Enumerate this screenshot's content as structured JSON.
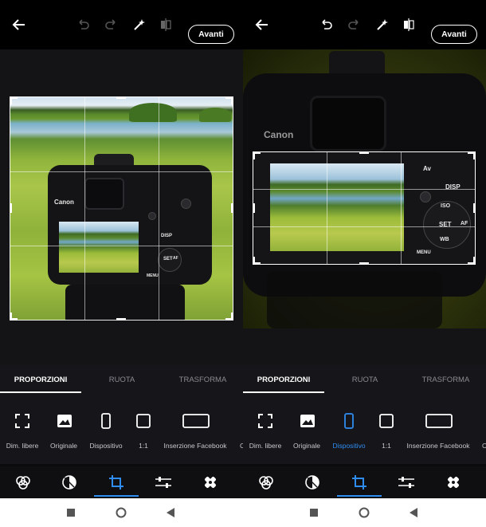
{
  "toolbar": {
    "back_icon": "arrow-left-icon",
    "undo_icon": "undo-icon",
    "redo_icon": "redo-icon",
    "auto_icon": "magic-wand-icon",
    "compare_icon": "compare-icon",
    "next_label": "Avanti"
  },
  "tabs": [
    {
      "label": "PROPORZIONI",
      "active": true
    },
    {
      "label": "RUOTA",
      "active": false
    },
    {
      "label": "TRASFORMA",
      "active": false
    }
  ],
  "screens": [
    {
      "selected_option": "Originale",
      "options": [
        {
          "label": "Dim. libere",
          "icon": "free-size-icon"
        },
        {
          "label": "Originale",
          "icon": "image-icon"
        },
        {
          "label": "Dispositivo",
          "icon": "phone-icon"
        },
        {
          "label": "1:1",
          "icon": "square-icon"
        },
        {
          "label": "Inserzione Facebook",
          "icon": "wide-rect-icon"
        },
        {
          "label": "C",
          "icon": ""
        }
      ]
    },
    {
      "selected_option": "Dispositivo",
      "options": [
        {
          "label": "Dim. libere",
          "icon": "free-size-icon"
        },
        {
          "label": "Originale",
          "icon": "image-icon"
        },
        {
          "label": "Dispositivo",
          "icon": "phone-icon"
        },
        {
          "label": "1:1",
          "icon": "square-icon"
        },
        {
          "label": "Inserzione Facebook",
          "icon": "wide-rect-icon"
        },
        {
          "label": "C",
          "icon": ""
        }
      ]
    }
  ],
  "camera": {
    "brand": "Canon",
    "buttons": [
      "DISP",
      "SET",
      "AF",
      "ISO",
      "WB",
      "MENU",
      "Av"
    ]
  },
  "bottom_tools": [
    "looks-icon",
    "adjust-circle-icon",
    "crop-icon",
    "sliders-icon",
    "healing-icon"
  ],
  "active_tool": "crop-icon",
  "navbar": [
    "recents-square-icon",
    "home-circle-icon",
    "back-triangle-icon"
  ],
  "colors": {
    "accent": "#2f8cf0",
    "background": "#0b0b0d",
    "panel": "#16161a"
  }
}
